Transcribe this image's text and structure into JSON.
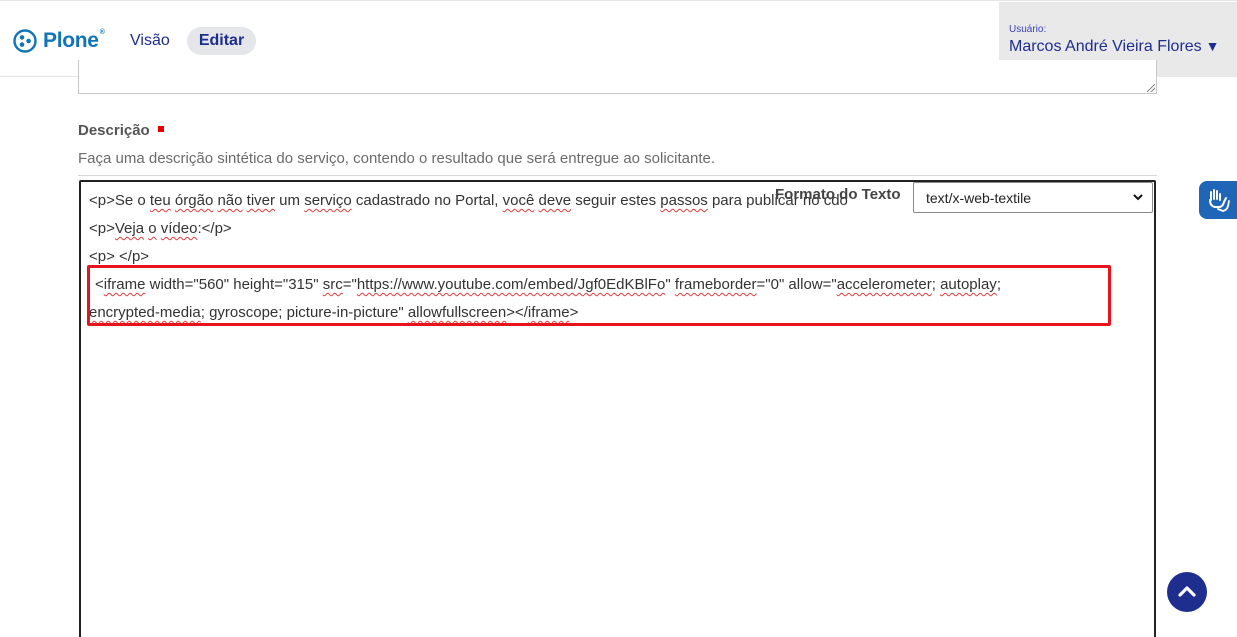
{
  "toolbar": {
    "logo_text": "Plone",
    "logo_reg": "®",
    "view_label": "Visão",
    "edit_label": "Editar",
    "user_label": "Usuário:",
    "user_name": "Marcos André Vieira Flores",
    "user_caret": "▼"
  },
  "form": {
    "description_label": "Descrição",
    "description_help": "Faça uma descrição sintética do serviço, contendo o resultado que será entregue ao solicitante.",
    "text_format_label": "Formato do Texto",
    "text_format_value": "text/x-web-textile"
  },
  "editor": {
    "line1": {
      "p1": "<p>Se o ",
      "w1": "teu",
      "p2": " ",
      "w2": "órgão",
      "p3": " ",
      "w3": "não",
      "p4": " ",
      "w4": "tiver",
      "p5": " um ",
      "w5": "serviço",
      "p6": " cadastrado no Portal, ",
      "w6": "você",
      "p7": " ",
      "w7": "deve",
      "p8": " seguir estes ",
      "w8": "passos",
      "p9": " para publicar no cdo"
    },
    "line2": {
      "p1": "<p>",
      "w1": "Veja",
      "p2": " ",
      "w2": "o",
      "p3": " ",
      "w3": "vídeo",
      "p4": ":</p>"
    },
    "line3": {
      "text": "<p> </p>"
    },
    "line4": {
      "p1": "<",
      "w1": "iframe",
      "p2": " width=\"560\" height=\"315\" ",
      "w2": "src",
      "p3": "=\"",
      "w3": "https://www.youtube.com/embed/Jgf0EdKBlFo",
      "p4": "\" ",
      "w4": "frameborder",
      "p5": "=\"0\" allow=\"",
      "w5": "accelerometer",
      "p6": "; ",
      "w6": "autoplay",
      "p7": ";"
    },
    "line5": {
      "w1": "encrypted-media",
      "p1": "; gyroscope; picture-in-picture\" ",
      "w2": "allowfullscreen",
      "p2": "></",
      "w3": "iframe",
      "p3": ">"
    }
  },
  "colors": {
    "accent": "#1e2e8f",
    "plone_blue": "#0f74b8",
    "highlight": "#e8141c",
    "required": "#e00000"
  },
  "icons": {
    "logo": "plone-logo-icon",
    "caret": "caret-down-icon",
    "select_chevron": "chevron-down-icon",
    "accessibility": "sign-language-hands-icon",
    "scroll_top": "chevron-up-icon"
  }
}
